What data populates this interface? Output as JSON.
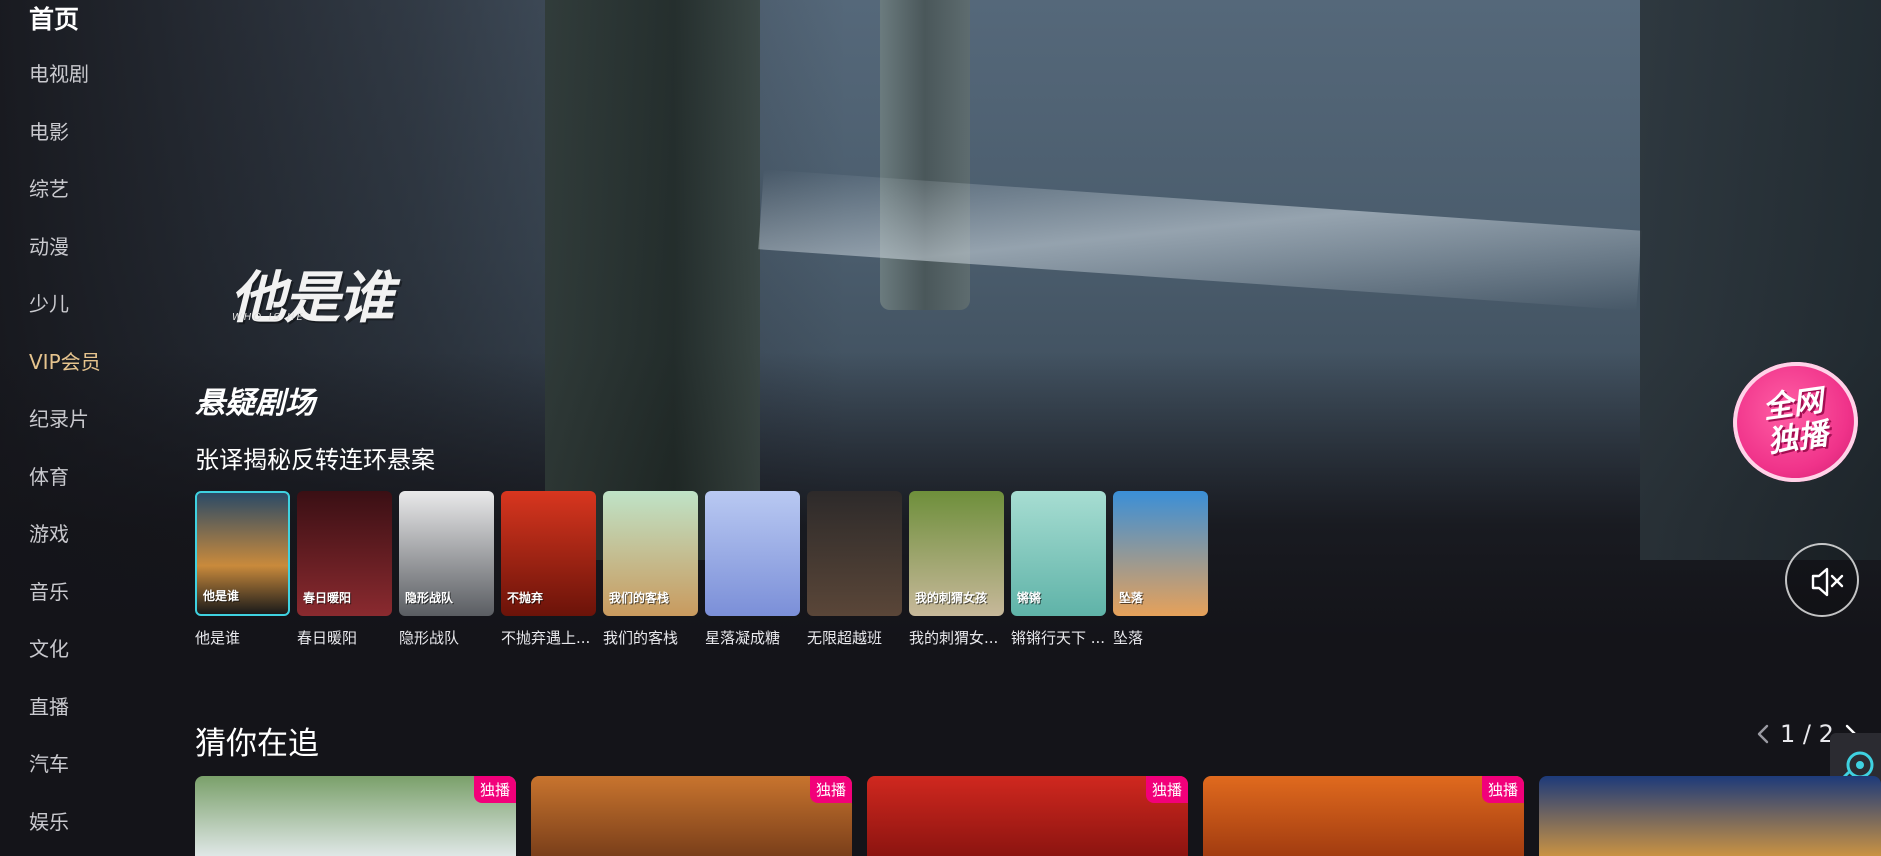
{
  "nav": {
    "items": [
      {
        "label": "首页"
      },
      {
        "label": "电视剧"
      },
      {
        "label": "电影"
      },
      {
        "label": "综艺"
      },
      {
        "label": "动漫"
      },
      {
        "label": "少儿"
      },
      {
        "label": "VIP会员"
      },
      {
        "label": "纪录片"
      },
      {
        "label": "体育"
      },
      {
        "label": "游戏"
      },
      {
        "label": "音乐"
      },
      {
        "label": "文化"
      },
      {
        "label": "直播"
      },
      {
        "label": "汽车"
      },
      {
        "label": "娱乐"
      }
    ]
  },
  "hero": {
    "show_logo": "他是谁",
    "show_logo_sub": "WHO IS HE",
    "theater_logo": "悬疑剧场",
    "tagline": "张译揭秘反转连环悬案",
    "badge_line1": "全网",
    "badge_line2": "独播",
    "mute_icon": "mute-speaker-icon"
  },
  "carousel": {
    "items": [
      {
        "title": "他是谁",
        "poster_text": "他是谁",
        "color_a": "#2b4a66",
        "color_b": "#c98a3c"
      },
      {
        "title": "春日暖阳",
        "poster_text": "春日暖阳",
        "color_a": "#3a0f14",
        "color_b": "#8a2a2f"
      },
      {
        "title": "隐形战队",
        "poster_text": "隐形战队",
        "color_a": "#e9e9ea",
        "color_b": "#5a5d62"
      },
      {
        "title": "不抛弃遇上...",
        "poster_text": "不抛弃",
        "color_a": "#d8361f",
        "color_b": "#6b1309"
      },
      {
        "title": "我们的客栈",
        "poster_text": "我们的客栈",
        "color_a": "#bfe3c7",
        "color_b": "#c99a5e"
      },
      {
        "title": "星落凝成糖",
        "poster_text": "",
        "color_a": "#b9c9f2",
        "color_b": "#7b8fd8"
      },
      {
        "title": "无限超越班",
        "poster_text": "",
        "color_a": "#2d2a2a",
        "color_b": "#5a4638"
      },
      {
        "title": "我的刺猬女...",
        "poster_text": "我的刺猬女孩",
        "color_a": "#6e8f3b",
        "color_b": "#c7b89a"
      },
      {
        "title": "锵锵行天下 ...",
        "poster_text": "锵锵",
        "color_a": "#a7ddd2",
        "color_b": "#5fb3a8"
      },
      {
        "title": "坠落",
        "poster_text": "坠落",
        "color_a": "#3a8fd8",
        "color_b": "#e6a15a"
      }
    ]
  },
  "section": {
    "title": "猜你在追",
    "pager_text": "1 / 2",
    "prev_icon": "chevron-left-icon",
    "next_icon": "chevron-right-icon"
  },
  "cards": {
    "tag": "独播",
    "items": [
      {
        "color_a": "#7aa06a",
        "color_b": "#dfe7e6"
      },
      {
        "color_a": "#c8742e",
        "color_b": "#7a3f1a"
      },
      {
        "color_a": "#d0281f",
        "color_b": "#8c1410"
      },
      {
        "color_a": "#e06a1e",
        "color_b": "#a23c10"
      },
      {
        "color_a": "#1d3a7a",
        "color_b": "#c99243"
      }
    ]
  },
  "colors": {
    "accent_cyan": "#3fd1e0",
    "exclusive_pink": "#f2007a",
    "vip_gold": "#e6c48e"
  }
}
